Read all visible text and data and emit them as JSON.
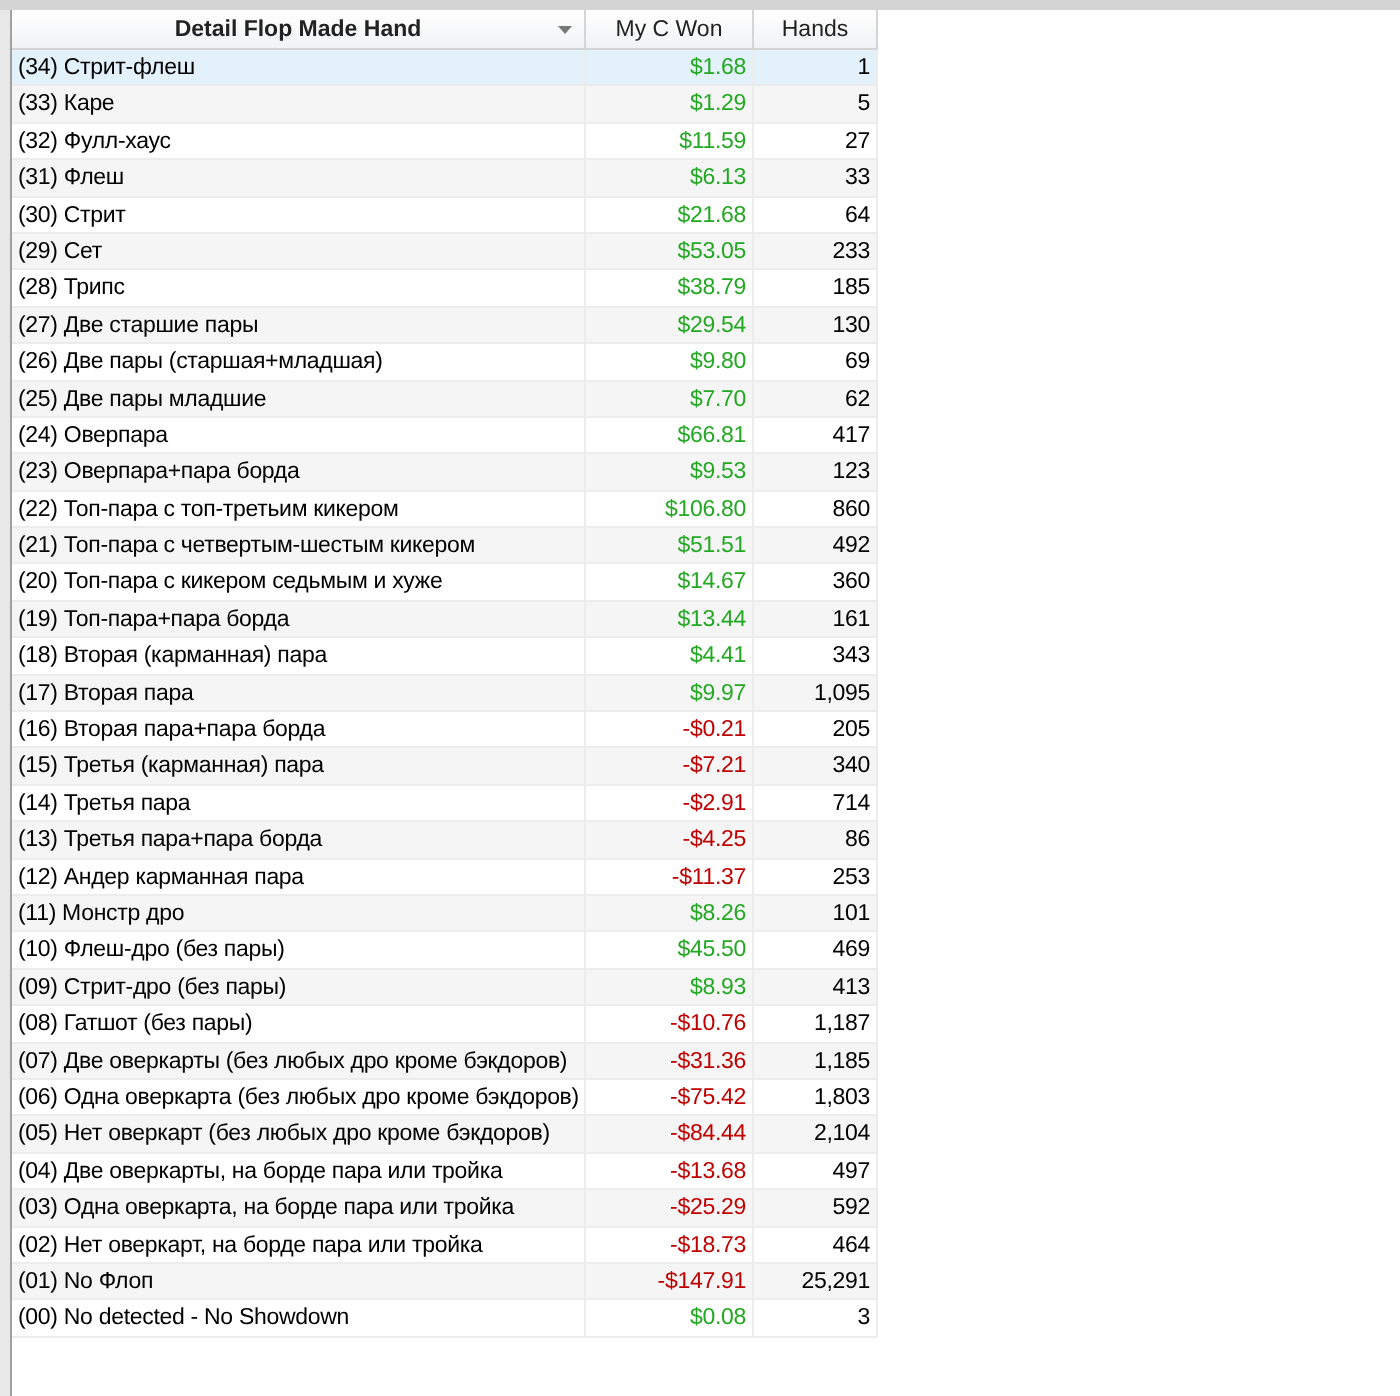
{
  "table": {
    "columns": [
      {
        "label": "Detail Flop Made Hand",
        "sort_menu": true
      },
      {
        "label": "My C Won",
        "sort_menu": false
      },
      {
        "label": "Hands",
        "sort_menu": false
      }
    ],
    "rows": [
      {
        "hand": "(34) Стрит-флеш",
        "won": "$1.68",
        "color": "#22a822",
        "hands": "1",
        "selected": true
      },
      {
        "hand": "(33) Каре",
        "won": "$1.29",
        "color": "#22a822",
        "hands": "5",
        "selected": false
      },
      {
        "hand": "(32) Фулл-хаус",
        "won": "$11.59",
        "color": "#22a822",
        "hands": "27",
        "selected": false
      },
      {
        "hand": "(31) Флеш",
        "won": "$6.13",
        "color": "#22a822",
        "hands": "33",
        "selected": false
      },
      {
        "hand": "(30) Стрит",
        "won": "$21.68",
        "color": "#22a822",
        "hands": "64",
        "selected": false
      },
      {
        "hand": "(29) Сет",
        "won": "$53.05",
        "color": "#22a822",
        "hands": "233",
        "selected": false
      },
      {
        "hand": "(28) Трипс",
        "won": "$38.79",
        "color": "#22a822",
        "hands": "185",
        "selected": false
      },
      {
        "hand": "(27) Две старшие пары",
        "won": "$29.54",
        "color": "#22a822",
        "hands": "130",
        "selected": false
      },
      {
        "hand": "(26) Две пары (старшая+младшая)",
        "won": "$9.80",
        "color": "#22a822",
        "hands": "69",
        "selected": false
      },
      {
        "hand": "(25) Две пары младшие",
        "won": "$7.70",
        "color": "#22a822",
        "hands": "62",
        "selected": false
      },
      {
        "hand": "(24) Оверпара",
        "won": "$66.81",
        "color": "#22a822",
        "hands": "417",
        "selected": false
      },
      {
        "hand": "(23) Оверпара+пара борда",
        "won": "$9.53",
        "color": "#22a822",
        "hands": "123",
        "selected": false
      },
      {
        "hand": "(22) Топ-пара с топ-третьим кикером",
        "won": "$106.80",
        "color": "#22a822",
        "hands": "860",
        "selected": false
      },
      {
        "hand": "(21) Топ-пара с четвертым-шестым кикером",
        "won": "$51.51",
        "color": "#22a822",
        "hands": "492",
        "selected": false
      },
      {
        "hand": "(20) Топ-пара с кикером седьмым и хуже",
        "won": "$14.67",
        "color": "#22a822",
        "hands": "360",
        "selected": false
      },
      {
        "hand": "(19) Топ-пара+пара борда",
        "won": "$13.44",
        "color": "#22a822",
        "hands": "161",
        "selected": false
      },
      {
        "hand": "(18) Вторая (карманная) пара",
        "won": "$4.41",
        "color": "#22a822",
        "hands": "343",
        "selected": false
      },
      {
        "hand": "(17) Вторая пара",
        "won": "$9.97",
        "color": "#22a822",
        "hands": "1,095",
        "selected": false
      },
      {
        "hand": "(16) Вторая пара+пара борда",
        "won": "-$0.21",
        "color": "#c00000",
        "hands": "205",
        "selected": false
      },
      {
        "hand": "(15) Третья (карманная) пара",
        "won": "-$7.21",
        "color": "#c00000",
        "hands": "340",
        "selected": false
      },
      {
        "hand": "(14) Третья пара",
        "won": "-$2.91",
        "color": "#c00000",
        "hands": "714",
        "selected": false
      },
      {
        "hand": "(13) Третья пара+пара борда",
        "won": "-$4.25",
        "color": "#c00000",
        "hands": "86",
        "selected": false
      },
      {
        "hand": "(12) Андер карманная пара",
        "won": "-$11.37",
        "color": "#c00000",
        "hands": "253",
        "selected": false
      },
      {
        "hand": "(11) Монстр дро",
        "won": "$8.26",
        "color": "#22a822",
        "hands": "101",
        "selected": false
      },
      {
        "hand": "(10) Флеш-дро (без пары)",
        "won": "$45.50",
        "color": "#22a822",
        "hands": "469",
        "selected": false
      },
      {
        "hand": "(09) Стрит-дро (без пары)",
        "won": "$8.93",
        "color": "#22a822",
        "hands": "413",
        "selected": false
      },
      {
        "hand": "(08) Гатшот (без пары)",
        "won": "-$10.76",
        "color": "#c00000",
        "hands": "1,187",
        "selected": false
      },
      {
        "hand": "(07) Две оверкарты (без любых дро кроме бэкдоров)",
        "won": "-$31.36",
        "color": "#c00000",
        "hands": "1,185",
        "selected": false
      },
      {
        "hand": "(06) Одна оверкарта (без любых дро кроме бэкдоров)",
        "won": "-$75.42",
        "color": "#c00000",
        "hands": "1,803",
        "selected": false
      },
      {
        "hand": "(05) Нет оверкарт (без любых дро кроме бэкдоров)",
        "won": "-$84.44",
        "color": "#c00000",
        "hands": "2,104",
        "selected": false
      },
      {
        "hand": "(04) Две оверкарты, на борде пара или тройка",
        "won": "-$13.68",
        "color": "#c00000",
        "hands": "497",
        "selected": false
      },
      {
        "hand": "(03) Одна оверкарта, на борде пара или тройка",
        "won": "-$25.29",
        "color": "#c00000",
        "hands": "592",
        "selected": false
      },
      {
        "hand": "(02) Нет оверкарт, на борде пара или тройка",
        "won": "-$18.73",
        "color": "#c00000",
        "hands": "464",
        "selected": false
      },
      {
        "hand": "(01) No Флоп",
        "won": "-$147.91",
        "color": "#c00000",
        "hands": "25,291",
        "selected": false
      },
      {
        "hand": "(00) No detected - No Showdown",
        "won": "$0.08",
        "color": "#22a822",
        "hands": "3",
        "selected": false
      }
    ]
  }
}
